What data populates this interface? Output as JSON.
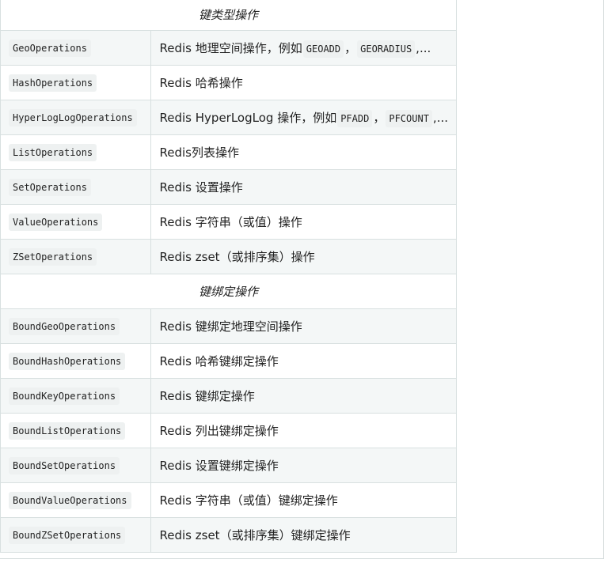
{
  "sections": [
    {
      "title": "键类型操作",
      "rows": [
        {
          "name": "GeoOperations",
          "desc": [
            {
              "t": "Redis 地理空间操作，例如"
            },
            {
              "c": "GEOADD"
            },
            {
              "t": "，"
            },
            {
              "c": "GEORADIUS"
            },
            {
              "t": ",..."
            }
          ]
        },
        {
          "name": "HashOperations",
          "desc": [
            {
              "t": "Redis 哈希操作"
            }
          ]
        },
        {
          "name": "HyperLogLogOperations",
          "desc": [
            {
              "t": "Redis HyperLogLog 操作，例如"
            },
            {
              "c": "PFADD"
            },
            {
              "t": "，"
            },
            {
              "c": "PFCOUNT"
            },
            {
              "t": ",..."
            }
          ]
        },
        {
          "name": "ListOperations",
          "desc": [
            {
              "t": "Redis列表操作"
            }
          ]
        },
        {
          "name": "SetOperations",
          "desc": [
            {
              "t": "Redis 设置操作"
            }
          ]
        },
        {
          "name": "ValueOperations",
          "desc": [
            {
              "t": "Redis 字符串（或值）操作"
            }
          ]
        },
        {
          "name": "ZSetOperations",
          "desc": [
            {
              "t": "Redis zset（或排序集）操作"
            }
          ]
        }
      ]
    },
    {
      "title": "键绑定操作",
      "rows": [
        {
          "name": "BoundGeoOperations",
          "desc": [
            {
              "t": "Redis 键绑定地理空间操作"
            }
          ]
        },
        {
          "name": "BoundHashOperations",
          "desc": [
            {
              "t": "Redis 哈希键绑定操作"
            }
          ]
        },
        {
          "name": "BoundKeyOperations",
          "desc": [
            {
              "t": "Redis 键绑定操作"
            }
          ]
        },
        {
          "name": "BoundListOperations",
          "desc": [
            {
              "t": "Redis 列出键绑定操作"
            }
          ]
        },
        {
          "name": "BoundSetOperations",
          "desc": [
            {
              "t": "Redis 设置键绑定操作"
            }
          ]
        },
        {
          "name": "BoundValueOperations",
          "desc": [
            {
              "t": "Redis 字符串（或值）键绑定操作"
            }
          ]
        },
        {
          "name": "BoundZSetOperations",
          "desc": [
            {
              "t": "Redis zset（或排序集）键绑定操作"
            }
          ]
        }
      ]
    }
  ]
}
